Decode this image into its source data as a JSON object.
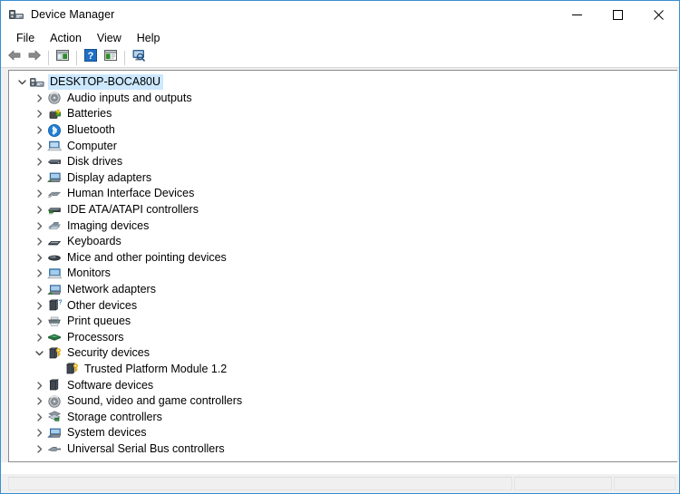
{
  "window": {
    "title": "Device Manager",
    "app_icon": "device-manager-icon",
    "accent_border": "#3a8fd1",
    "selection_color": "#cce8ff",
    "controls": [
      {
        "name": "minimize",
        "glyph": "minimize-icon"
      },
      {
        "name": "maximize",
        "glyph": "maximize-icon"
      },
      {
        "name": "close",
        "glyph": "close-icon"
      }
    ]
  },
  "menubar": {
    "items": [
      {
        "label": "File"
      },
      {
        "label": "Action"
      },
      {
        "label": "View"
      },
      {
        "label": "Help"
      }
    ]
  },
  "toolbar": {
    "buttons": [
      {
        "name": "back-button",
        "icon": "back-arrow-icon"
      },
      {
        "name": "forward-button",
        "icon": "forward-arrow-icon"
      },
      {
        "name": "separator-1",
        "icon": "separator"
      },
      {
        "name": "show-hide-console-tree-button",
        "icon": "console-tree-icon"
      },
      {
        "name": "separator-2",
        "icon": "separator"
      },
      {
        "name": "help-button",
        "icon": "question-mark-icon"
      },
      {
        "name": "properties-button",
        "icon": "properties-icon"
      },
      {
        "name": "separator-3",
        "icon": "separator"
      },
      {
        "name": "scan-for-hardware-changes-button",
        "icon": "scan-hardware-icon"
      }
    ]
  },
  "tree": {
    "root": {
      "label": "DESKTOP-BOCA80U",
      "icon": "computer-tree-root-icon",
      "expanded": true,
      "selected": true,
      "depth": 0
    },
    "nodes": [
      {
        "label": "Audio inputs and outputs",
        "icon": "speaker-icon",
        "expanded": false,
        "depth": 1
      },
      {
        "label": "Batteries",
        "icon": "battery-icon",
        "expanded": false,
        "depth": 1
      },
      {
        "label": "Bluetooth",
        "icon": "bluetooth-icon",
        "expanded": false,
        "depth": 1
      },
      {
        "label": "Computer",
        "icon": "computer-icon",
        "expanded": false,
        "depth": 1
      },
      {
        "label": "Disk drives",
        "icon": "disk-drive-icon",
        "expanded": false,
        "depth": 1
      },
      {
        "label": "Display adapters",
        "icon": "display-adapter-icon",
        "expanded": false,
        "depth": 1
      },
      {
        "label": "Human Interface Devices",
        "icon": "hid-icon",
        "expanded": false,
        "depth": 1
      },
      {
        "label": "IDE ATA/ATAPI controllers",
        "icon": "ide-controller-icon",
        "expanded": false,
        "depth": 1
      },
      {
        "label": "Imaging devices",
        "icon": "imaging-device-icon",
        "expanded": false,
        "depth": 1
      },
      {
        "label": "Keyboards",
        "icon": "keyboard-icon",
        "expanded": false,
        "depth": 1
      },
      {
        "label": "Mice and other pointing devices",
        "icon": "mouse-icon",
        "expanded": false,
        "depth": 1
      },
      {
        "label": "Monitors",
        "icon": "monitor-icon",
        "expanded": false,
        "depth": 1
      },
      {
        "label": "Network adapters",
        "icon": "network-adapter-icon",
        "expanded": false,
        "depth": 1
      },
      {
        "label": "Other devices",
        "icon": "other-device-icon",
        "expanded": false,
        "depth": 1
      },
      {
        "label": "Print queues",
        "icon": "printer-icon",
        "expanded": false,
        "depth": 1
      },
      {
        "label": "Processors",
        "icon": "processor-icon",
        "expanded": false,
        "depth": 1
      },
      {
        "label": "Security devices",
        "icon": "security-device-icon",
        "expanded": true,
        "depth": 1
      },
      {
        "label": "Trusted Platform Module 1.2",
        "icon": "security-device-icon",
        "expanded": null,
        "depth": 2
      },
      {
        "label": "Software devices",
        "icon": "software-device-icon",
        "expanded": false,
        "depth": 1
      },
      {
        "label": "Sound, video and game controllers",
        "icon": "speaker-icon",
        "expanded": false,
        "depth": 1
      },
      {
        "label": "Storage controllers",
        "icon": "storage-controller-icon",
        "expanded": false,
        "depth": 1
      },
      {
        "label": "System devices",
        "icon": "system-device-icon",
        "expanded": false,
        "depth": 1
      },
      {
        "label": "Universal Serial Bus controllers",
        "icon": "usb-controller-icon",
        "expanded": false,
        "depth": 1
      }
    ]
  },
  "statusbar": {
    "main": "",
    "second": "",
    "third": ""
  }
}
